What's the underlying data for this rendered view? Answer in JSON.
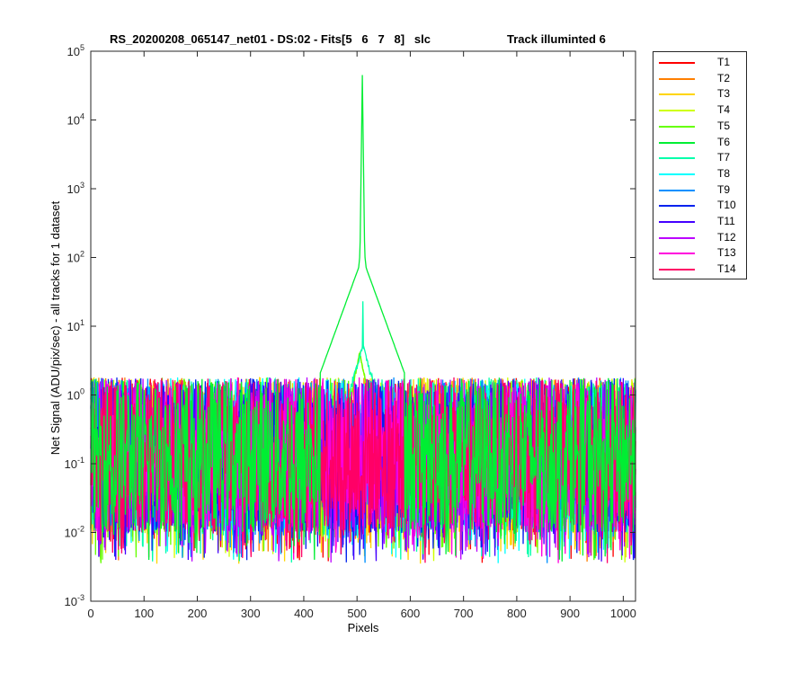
{
  "chart_data": {
    "type": "line",
    "title_left": "RS_20200208_065147_net01 - DS:02 - Fits[5   6   7   8]   slc",
    "title_right": "Track illuminted 6",
    "xlabel": "Pixels",
    "ylabel": "Net Signal (ADU/pix/sec) - all tracks for 1 dataset",
    "xlim": [
      0,
      1023
    ],
    "ylim": [
      0.001,
      100000
    ],
    "yscale": "log",
    "xticks": [
      "0",
      "100",
      "200",
      "300",
      "400",
      "500",
      "600",
      "700",
      "800",
      "900",
      "1000"
    ],
    "yticks_exponents": [
      "-3",
      "-2",
      "-1",
      "0",
      "1",
      "2",
      "3",
      "4",
      "5"
    ],
    "ytick_base": "10",
    "grid": false,
    "legend_position": "outside-right",
    "series": [
      {
        "name": "T1",
        "color": "#ff0000"
      },
      {
        "name": "T2",
        "color": "#ff7f00"
      },
      {
        "name": "T3",
        "color": "#ffd500"
      },
      {
        "name": "T4",
        "color": "#cfff00"
      },
      {
        "name": "T5",
        "color": "#66ff00"
      },
      {
        "name": "T6",
        "color": "#00ee33"
      },
      {
        "name": "T7",
        "color": "#00ffaa"
      },
      {
        "name": "T8",
        "color": "#00ffff"
      },
      {
        "name": "T9",
        "color": "#0090ff"
      },
      {
        "name": "T10",
        "color": "#0022ee"
      },
      {
        "name": "T11",
        "color": "#4400ff"
      },
      {
        "name": "T12",
        "color": "#bb00ff"
      },
      {
        "name": "T13",
        "color": "#ff00dd"
      },
      {
        "name": "T14",
        "color": "#ff0066"
      }
    ],
    "peak": {
      "series": "T6",
      "x": 510,
      "y": 45000
    },
    "secondary_peak": {
      "series": "T7",
      "x": 511,
      "y": 23
    },
    "noise_band": {
      "typical_min": 0.01,
      "typical_max": 1.8,
      "outlier_min": 0.0035
    }
  }
}
